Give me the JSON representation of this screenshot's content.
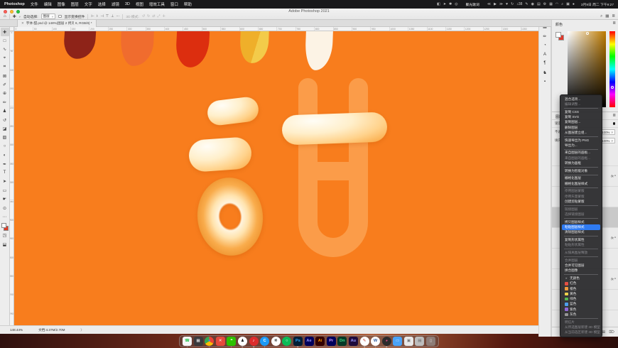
{
  "menubar": {
    "apple_glyph": "",
    "items": [
      "Photoshop",
      "文件",
      "编辑",
      "图像",
      "图层",
      "文字",
      "选择",
      "滤镜",
      "3D",
      "视图",
      "增效工具",
      "窗口",
      "帮助"
    ],
    "status_icons": [
      {
        "name": "screen-mirroring-icon",
        "g": "◧"
      },
      {
        "name": "pointer-icon",
        "g": "➤"
      },
      {
        "name": "paw-icon",
        "g": "✱"
      },
      {
        "name": "compass-icon",
        "g": "◎"
      }
    ],
    "status_text": "聚光歌词",
    "media_icons": [
      {
        "name": "previous-track-icon",
        "g": "≪"
      },
      {
        "name": "play-icon",
        "g": "▶"
      },
      {
        "name": "next-track-icon",
        "g": "≫"
      },
      {
        "name": "heart-icon",
        "g": "♥"
      },
      {
        "name": "repeat-icon",
        "g": "↻"
      },
      {
        "name": "notification-bell-icon",
        "g": "♪38"
      },
      {
        "name": "pencil-icon",
        "g": "✎"
      },
      {
        "name": "record-icon",
        "g": "◉"
      },
      {
        "name": "printer-icon",
        "g": "▤"
      },
      {
        "name": "settings-gear-icon",
        "g": "⚙"
      },
      {
        "name": "box-icon",
        "g": "▦"
      },
      {
        "name": "wifi-icon",
        "g": "◠"
      },
      {
        "name": "search-icon",
        "g": "⌕"
      },
      {
        "name": "input-source-icon",
        "g": "▣"
      },
      {
        "name": "bluetooth-dot-icon",
        "g": "●"
      }
    ],
    "clock": "3月9日 周二 下午9:27"
  },
  "titlebar": {
    "title": "Adobe Photoshop 2021",
    "light_colors": [
      {
        "name": "close-window-button",
        "color": "#FF5F57"
      },
      {
        "name": "minimize-window-button",
        "color": "#FEBC2E"
      },
      {
        "name": "zoom-window-button",
        "color": "#28C840"
      }
    ]
  },
  "options_bar": {
    "home_glyph": "⌂",
    "move_glyph": "✚",
    "chevron": "˅",
    "auto_select_label": "自动选择:",
    "auto_select_value": "图层",
    "show_transform_label": "显示变换控件",
    "align_icons": [
      {
        "name": "align-left-icon",
        "g": "⊢"
      },
      {
        "name": "align-center-h-icon",
        "g": "⊦"
      },
      {
        "name": "align-right-icon",
        "g": "⊣"
      },
      {
        "name": "align-top-icon",
        "g": "⊤"
      },
      {
        "name": "align-middle-icon",
        "g": "⊥"
      },
      {
        "name": "distribute-icon",
        "g": "⋯"
      }
    ],
    "threed_label": "3D 模式:",
    "threed_icons": [
      {
        "name": "3d-orbit-icon",
        "g": "↺"
      },
      {
        "name": "3d-roll-icon",
        "g": "↻"
      },
      {
        "name": "3d-pan-icon",
        "g": "⇄"
      },
      {
        "name": "3d-slide-icon",
        "g": "⤢"
      },
      {
        "name": "3d-scale-icon",
        "g": "✛"
      }
    ],
    "chrome_right_icons": [
      {
        "name": "search-icon",
        "g": "⌕"
      },
      {
        "name": "extras-icon",
        "g": "▦"
      },
      {
        "name": "workspace-switcher-icon",
        "g": "≣"
      }
    ]
  },
  "doc_tab": {
    "close_glyph": "✕",
    "title": "字体-甜.psd @ 148%(图层 2 拷贝 6, RGB/8) *"
  },
  "toolbar": {
    "tools": [
      {
        "name": "move-tool",
        "g": "✚",
        "selected": true
      },
      {
        "name": "marquee-tool",
        "g": "□"
      },
      {
        "name": "lasso-tool",
        "g": "∿"
      },
      {
        "name": "object-selection-tool",
        "g": "⌖"
      },
      {
        "name": "crop-tool",
        "g": "⌗"
      },
      {
        "name": "frame-tool",
        "g": "⊠"
      },
      {
        "name": "eyedropper-tool",
        "g": "✐"
      },
      {
        "name": "healing-brush-tool",
        "g": "⊕"
      },
      {
        "name": "brush-tool",
        "g": "✏"
      },
      {
        "name": "clone-stamp-tool",
        "g": "♟"
      },
      {
        "name": "history-brush-tool",
        "g": "↺"
      },
      {
        "name": "eraser-tool",
        "g": "◪"
      },
      {
        "name": "gradient-tool",
        "g": "▨"
      },
      {
        "name": "blur-tool",
        "g": "○"
      },
      {
        "name": "dodge-tool",
        "g": "◐"
      },
      {
        "name": "pen-tool",
        "g": "✒"
      },
      {
        "name": "type-tool",
        "g": "T"
      },
      {
        "name": "path-selection-tool",
        "g": "➤"
      },
      {
        "name": "shape-tool",
        "g": "▭"
      },
      {
        "name": "hand-tool",
        "g": "☛"
      },
      {
        "name": "zoom-tool",
        "g": "⊙"
      },
      {
        "name": "toolbar-ellipsis",
        "g": "⋯"
      }
    ],
    "bottom_icons": [
      {
        "name": "quick-mask-icon",
        "g": "◳"
      },
      {
        "name": "screen-mode-icon",
        "g": "⬓"
      }
    ]
  },
  "rulers": {
    "h": [
      "0",
      "50",
      "100",
      "150",
      "200",
      "250",
      "300",
      "350",
      "400",
      "450",
      "500",
      "550",
      "600",
      "650",
      "700",
      "750",
      "800",
      "850",
      "900",
      "950",
      "1000",
      "1050",
      "1100",
      "1150",
      "1200",
      "1250",
      "1300",
      "1350",
      "1400"
    ],
    "v": [
      "0",
      "50",
      "100",
      "150",
      "200",
      "250",
      "300",
      "350",
      "400",
      "450",
      "500",
      "550",
      "600",
      "650",
      "700",
      "750",
      "800"
    ]
  },
  "canvas": {
    "bg": "#F87D1D",
    "flat": "#FB9C49",
    "strokes": [
      {
        "name": "paint-swatch-maroon",
        "background": "#8E2318"
      },
      {
        "name": "paint-swatch-orange",
        "background": "#F06C2E"
      },
      {
        "name": "paint-swatch-red",
        "background": "#DC2E0F"
      },
      {
        "name": "paint-swatch-gold",
        "background": "linear-gradient(105deg,#EFAF2A 55%,#F3CB4A 55%)"
      },
      {
        "name": "paint-swatch-cream",
        "background": "#FCF3E5"
      }
    ]
  },
  "panels": {
    "collapsed_icons": [
      {
        "name": "adjustments-panel-icon",
        "g": "▦"
      },
      {
        "name": "brush-settings-panel-icon",
        "g": "✏"
      },
      {
        "name": "clone-source-panel-icon",
        "g": "◔"
      },
      {
        "name": "character-panel-icon",
        "g": "A"
      },
      {
        "name": "paragraph-panel-icon",
        "g": "¶"
      },
      {
        "name": "libraries-panel-icon",
        "g": "♞"
      },
      {
        "name": "properties-panel-icon",
        "g": "▪"
      }
    ],
    "color_panel": {
      "tab": "颜色",
      "menu_glyph": "≣"
    },
    "layers_panel": {
      "tab": "图层",
      "menu_glyph": "≣",
      "lock_label": "锁定:",
      "lock_icons": [
        {
          "name": "lock-transparent-icon",
          "g": "▨"
        },
        {
          "name": "lock-pixels-icon",
          "g": "✚"
        },
        {
          "name": "lock-position-icon",
          "g": "⊕"
        }
      ],
      "opacity_label": "不透明度:",
      "opacity_value": "100%",
      "fill_label": "填充:",
      "fill_value": "100%",
      "dd_chevron": "˅",
      "rows": [
        {
          "fx": ""
        },
        {
          "fx": "fx ^"
        },
        {
          "fx": ""
        },
        {
          "fx": "",
          "sel": true
        },
        {
          "fx": "fx ^"
        },
        {
          "fx": ""
        },
        {
          "fx": "fx ^"
        },
        {
          "fx": ""
        },
        {
          "fx": ""
        }
      ],
      "bottom_icons": [
        {
          "name": "new-layer-button",
          "g": "⊞"
        },
        {
          "name": "delete-layer-button",
          "g": "⌦"
        }
      ]
    }
  },
  "context_menu": {
    "items": [
      {
        "type": "item",
        "label": "混合选项..."
      },
      {
        "type": "item",
        "label": "编辑调整...",
        "disabled": true
      },
      {
        "type": "sep"
      },
      {
        "type": "item",
        "label": "复制 CSS"
      },
      {
        "type": "item",
        "label": "复制 SVG"
      },
      {
        "type": "item",
        "label": "复制图层..."
      },
      {
        "type": "item",
        "label": "删除图层"
      },
      {
        "type": "item",
        "label": "从图层建立组..."
      },
      {
        "type": "sep"
      },
      {
        "type": "item",
        "label": "快速导出为 PNG"
      },
      {
        "type": "item",
        "label": "导出为..."
      },
      {
        "type": "sep"
      },
      {
        "type": "item",
        "label": "来自图层的画板..."
      },
      {
        "type": "item",
        "label": "来自图层的画框...",
        "disabled": true
      },
      {
        "type": "item",
        "label": "转换为画框"
      },
      {
        "type": "sep"
      },
      {
        "type": "item",
        "label": "转换为智能对象"
      },
      {
        "type": "sep"
      },
      {
        "type": "item",
        "label": "栅格化图层"
      },
      {
        "type": "item",
        "label": "栅格化图层样式"
      },
      {
        "type": "sep"
      },
      {
        "type": "item",
        "label": "停用图层蒙版",
        "disabled": true
      },
      {
        "type": "item",
        "label": "停用矢量蒙版",
        "disabled": true
      },
      {
        "type": "item",
        "label": "创建剪贴蒙版"
      },
      {
        "type": "sep"
      },
      {
        "type": "item",
        "label": "链接图层",
        "disabled": true
      },
      {
        "type": "item",
        "label": "选择链接图层",
        "disabled": true
      },
      {
        "type": "sep"
      },
      {
        "type": "item",
        "label": "拷贝图层样式"
      },
      {
        "type": "item",
        "label": "粘贴图层样式",
        "highlighted": true
      },
      {
        "type": "item",
        "label": "清除图层样式"
      },
      {
        "type": "sep"
      },
      {
        "type": "item",
        "label": "复制形状属性"
      },
      {
        "type": "item",
        "label": "粘贴形状属性",
        "disabled": true
      },
      {
        "type": "sep"
      },
      {
        "type": "item",
        "label": "从隔离图层释放",
        "disabled": true
      },
      {
        "type": "sep"
      },
      {
        "type": "item",
        "label": "合并图层",
        "disabled": true
      },
      {
        "type": "item",
        "label": "合并可见图层"
      },
      {
        "type": "item",
        "label": "拼合图像"
      },
      {
        "type": "sep"
      },
      {
        "type": "color",
        "label": "无颜色",
        "glyph": "✕",
        "swatch": "transparent"
      },
      {
        "type": "color",
        "label": "红色",
        "swatch": "#E34F44"
      },
      {
        "type": "color",
        "label": "橙色",
        "swatch": "#EE9A3C"
      },
      {
        "type": "color",
        "label": "黄色",
        "swatch": "#EFD24C"
      },
      {
        "type": "color",
        "label": "绿色",
        "swatch": "#55B853"
      },
      {
        "type": "color",
        "label": "蓝色",
        "swatch": "#4E9EEA"
      },
      {
        "type": "color",
        "label": "紫色",
        "swatch": "#9268D6"
      },
      {
        "type": "color",
        "label": "灰色",
        "swatch": "#969696"
      },
      {
        "type": "sep"
      },
      {
        "type": "item",
        "label": "明信片",
        "disabled": true
      },
      {
        "type": "item",
        "label": "从所选图层新建 3D 模型",
        "disabled": true
      },
      {
        "type": "item",
        "label": "从当前选区新建 3D 模型",
        "disabled": true
      }
    ]
  },
  "status_bar": {
    "zoom": "148.44%",
    "doc": "文档:4.37M/2.70M",
    "arrow": "〉"
  },
  "dock": {
    "apps": [
      {
        "name": "dock-contacts",
        "glyph": "☎",
        "bg": "#F5F5F7",
        "fg": "#34C759",
        "shape": "square",
        "running": true
      },
      {
        "name": "dock-launchpad",
        "glyph": "▦",
        "bg": "#3A3A3E",
        "fg": "#EEE",
        "shape": "square"
      },
      {
        "name": "dock-chrome",
        "glyph": "●",
        "bg": "conic-gradient(#EA4335 0 33%,#FBBC05 0 66%,#34A853 0 100%)",
        "fg": "#4285F4",
        "shape": "circle",
        "running": true
      },
      {
        "name": "dock-xmind",
        "glyph": "✕",
        "bg": "#E64A3C",
        "fg": "#FFF",
        "shape": "square"
      },
      {
        "name": "dock-wechat",
        "glyph": "❝",
        "bg": "#2DC100",
        "fg": "#FFF",
        "shape": "square",
        "running": true
      },
      {
        "name": "dock-qq",
        "glyph": "♟",
        "bg": "#FFFFFF",
        "fg": "#111",
        "shape": "circle",
        "running": true
      },
      {
        "name": "dock-netease-music",
        "glyph": "♪",
        "bg": "#DD2C2C",
        "fg": "#FFF",
        "shape": "circle",
        "running": true
      },
      {
        "name": "dock-safari",
        "glyph": "C",
        "bg": "#1B9AF7",
        "fg": "#FFF",
        "shape": "circle",
        "running": true
      },
      {
        "name": "dock-white-app",
        "glyph": "❋",
        "bg": "#FFFFFF",
        "fg": "#333",
        "shape": "circle"
      },
      {
        "name": "dock-green-app",
        "glyph": "○",
        "bg": "#0BBB57",
        "fg": "#FFF",
        "shape": "circle"
      },
      {
        "name": "dock-photoshop",
        "glyph": "Ps",
        "bg": "#001E36",
        "fg": "#31A8FF",
        "shape": "square",
        "running": true
      },
      {
        "name": "dock-after-effects",
        "glyph": "Ae",
        "bg": "#00005B",
        "fg": "#9999FF",
        "shape": "square"
      },
      {
        "name": "dock-illustrator",
        "glyph": "Ai",
        "bg": "#330000",
        "fg": "#FF9A00",
        "shape": "square"
      },
      {
        "name": "dock-premiere",
        "glyph": "Pr",
        "bg": "#00005B",
        "fg": "#D6A1FF",
        "shape": "square"
      },
      {
        "name": "dock-dimension",
        "glyph": "Dn",
        "bg": "#063926",
        "fg": "#3EE089",
        "shape": "square"
      },
      {
        "name": "dock-audition",
        "glyph": "Au",
        "bg": "#1E0A3C",
        "fg": "#9999FF",
        "shape": "square"
      },
      {
        "name": "dock-pen-app",
        "glyph": "✎",
        "bg": "#FFFFFF",
        "fg": "#C0392B",
        "shape": "circle",
        "running": true
      },
      {
        "name": "dock-word",
        "glyph": "W",
        "bg": "#FFFFFF",
        "fg": "#2B579A",
        "shape": "circle",
        "running": true
      },
      {
        "name": "dock-media-app",
        "glyph": "◕",
        "bg": "#2B2B2B",
        "fg": "#E74C8B",
        "shape": "circle",
        "running": true
      },
      {
        "name": "dock-downloads-folder",
        "glyph": "▭",
        "bg": "#4AA3F7",
        "fg": "#CFE6FF",
        "shape": "square"
      },
      {
        "name": "dock-preview-file",
        "glyph": "▣",
        "bg": "#E8E8E8",
        "fg": "#777",
        "shape": "square"
      },
      {
        "name": "dock-gray-item",
        "glyph": "▤",
        "bg": "#BDBDBD",
        "fg": "#666",
        "shape": "square"
      },
      {
        "name": "dock-trash",
        "glyph": "▯",
        "bg": "rgba(160,160,160,0.6)",
        "fg": "#EEE",
        "shape": "square"
      }
    ]
  }
}
